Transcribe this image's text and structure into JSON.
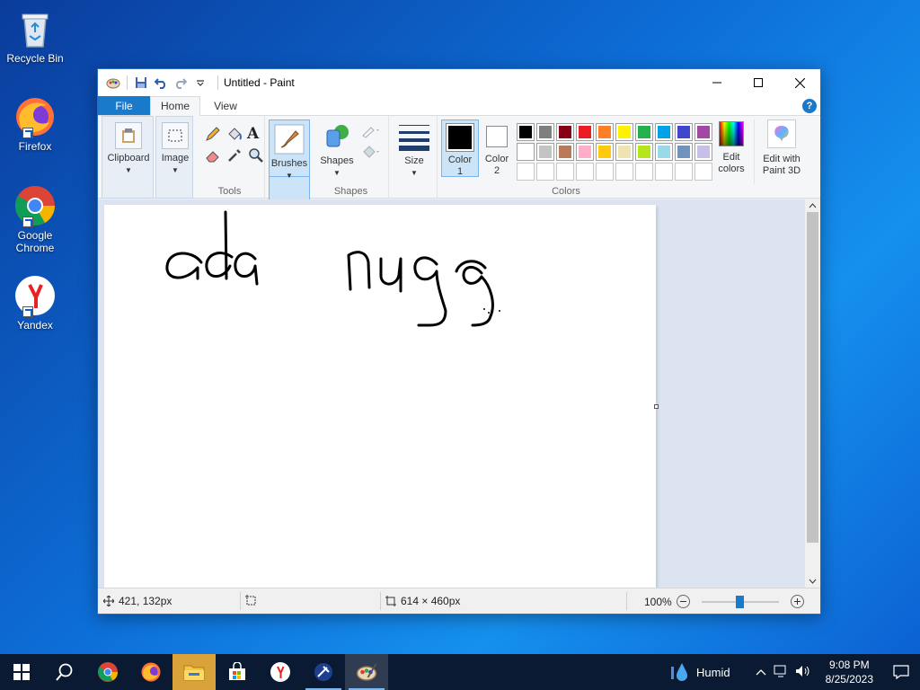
{
  "desktop": {
    "icons": [
      {
        "label": "Recycle Bin"
      },
      {
        "label": "Firefox"
      },
      {
        "label": "Google Chrome"
      },
      {
        "label": "Yandex"
      }
    ]
  },
  "window": {
    "title": "Untitled - Paint",
    "tabs": {
      "file": "File",
      "home": "Home",
      "view": "View"
    },
    "help": "?",
    "ribbon": {
      "clipboard": "Clipboard",
      "image": "Image",
      "tools_group": "Tools",
      "brushes": "Brushes",
      "shapes": "Shapes",
      "shapes_group": "Shapes",
      "size": "Size",
      "color1": "Color\n1",
      "color1_a": "Color",
      "color1_b": "1",
      "color2_a": "Color",
      "color2_b": "2",
      "edit_colors_a": "Edit",
      "edit_colors_b": "colors",
      "paint3d_a": "Edit with",
      "paint3d_b": "Paint 3D",
      "colors_group": "Colors"
    },
    "colors": {
      "color1_value": "#000000",
      "color2_value": "#ffffff",
      "palette_row1": [
        "#000000",
        "#7f7f7f",
        "#880015",
        "#ed1c24",
        "#ff7f27",
        "#fff200",
        "#22b14c",
        "#00a2e8",
        "#3f48cc",
        "#a349a4"
      ],
      "palette_row2": [
        "#ffffff",
        "#c3c3c3",
        "#b97a57",
        "#ffaec9",
        "#ffc90e",
        "#efe4b0",
        "#b5e61d",
        "#99d9ea",
        "#7092be",
        "#c8bfe7"
      ],
      "palette_row3": [
        "#ffffff",
        "#ffffff",
        "#ffffff",
        "#ffffff",
        "#ffffff",
        "#ffffff",
        "#ffffff",
        "#ffffff",
        "#ffffff",
        "#ffffff"
      ]
    },
    "status": {
      "cursor_pos": "421, 132px",
      "canvas_size": "614 × 460px",
      "zoom": "100%"
    }
  },
  "taskbar": {
    "weather": "Humid",
    "time": "9:08 PM",
    "date": "8/25/2023"
  }
}
